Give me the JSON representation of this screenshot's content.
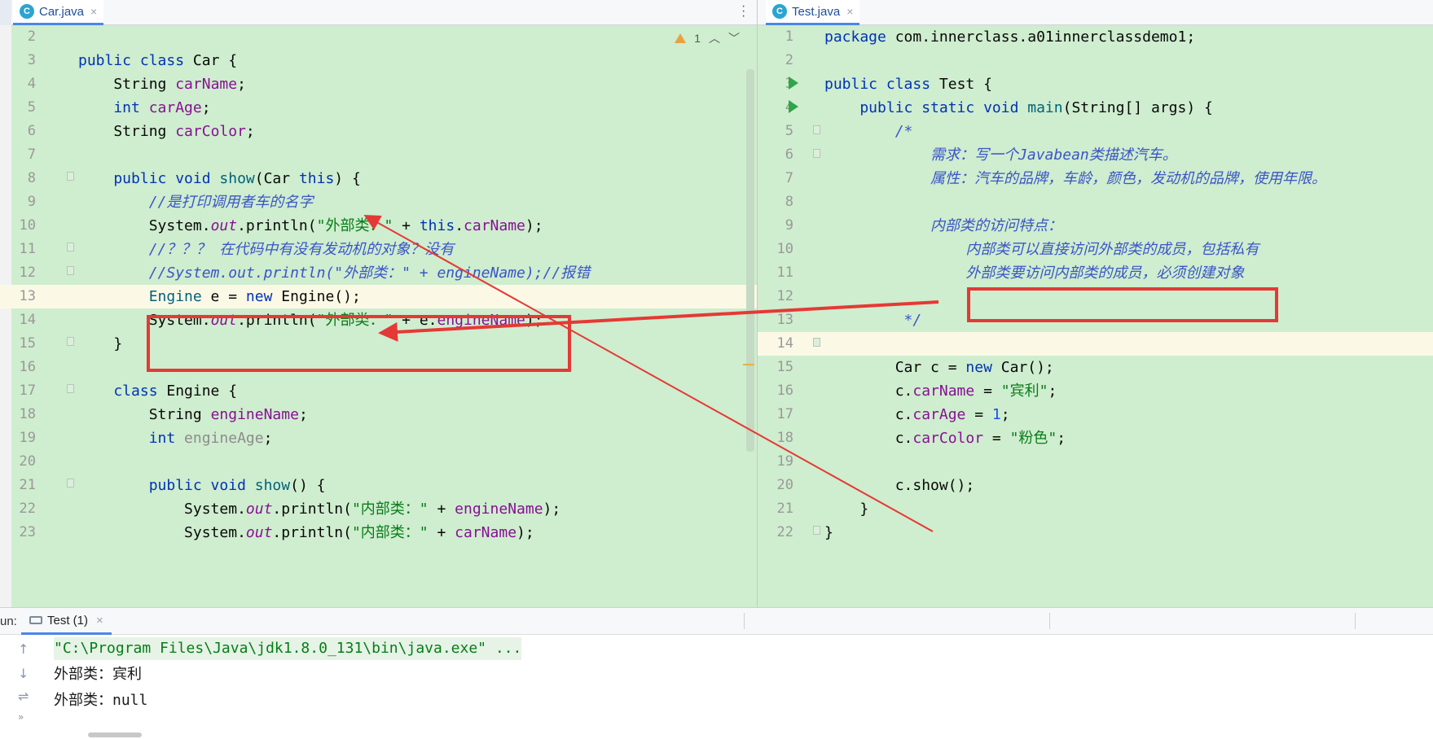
{
  "left_tab": {
    "icon_letter": "C",
    "name": "Car.java",
    "close": "×"
  },
  "right_tab": {
    "icon_letter": "C",
    "name": "Test.java",
    "close": "×"
  },
  "warnings": {
    "count": "1"
  },
  "left_lines": [
    {
      "n": "2",
      "tokens": []
    },
    {
      "n": "3",
      "tokens": [
        [
          "k",
          "public class "
        ],
        [
          "p",
          "Car {"
        ]
      ]
    },
    {
      "n": "4",
      "tokens": [
        [
          "p",
          "    String "
        ],
        [
          "f",
          "carName"
        ],
        [
          "p",
          ";"
        ]
      ]
    },
    {
      "n": "5",
      "tokens": [
        [
          "k",
          "    int "
        ],
        [
          "f",
          "carAge"
        ],
        [
          "p",
          ";"
        ]
      ]
    },
    {
      "n": "6",
      "tokens": [
        [
          "p",
          "    String "
        ],
        [
          "f",
          "carColor"
        ],
        [
          "p",
          ";"
        ]
      ]
    },
    {
      "n": "7",
      "tokens": []
    },
    {
      "n": "8",
      "tokens": [
        [
          "k",
          "    public void "
        ],
        [
          "m",
          "show"
        ],
        [
          "p",
          "(Car "
        ],
        [
          "k",
          "this"
        ],
        [
          "p",
          ") {"
        ]
      ]
    },
    {
      "n": "9",
      "tokens": [
        [
          "c",
          "        //是打印调用者车的名字"
        ]
      ]
    },
    {
      "n": "10",
      "tokens": [
        [
          "p",
          "        System."
        ],
        [
          "i",
          "out"
        ],
        [
          "p",
          ".println("
        ],
        [
          "s",
          "\"外部类：\""
        ],
        [
          "p",
          " + "
        ],
        [
          "k",
          "this"
        ],
        [
          "p",
          "."
        ],
        [
          "f",
          "carName"
        ],
        [
          "p",
          ");"
        ]
      ]
    },
    {
      "n": "11",
      "tokens": [
        [
          "c",
          "        //？？？ 在代码中有没有发动机的对象？没有"
        ]
      ]
    },
    {
      "n": "12",
      "tokens": [
        [
          "c",
          "        //System.out.println(\"外部类：\" + engineName);//报错"
        ]
      ]
    },
    {
      "n": "13",
      "tokens": [
        [
          "m",
          "        Engine"
        ],
        [
          "p",
          " e = "
        ],
        [
          "k",
          "new "
        ],
        [
          "p",
          "Engine();"
        ]
      ]
    },
    {
      "n": "14",
      "tokens": [
        [
          "p",
          "        System."
        ],
        [
          "i",
          "out"
        ],
        [
          "p",
          ".println("
        ],
        [
          "s",
          "\"外部类：\""
        ],
        [
          "p",
          " + e."
        ],
        [
          "f",
          "engineName"
        ],
        [
          "p",
          ");"
        ]
      ]
    },
    {
      "n": "15",
      "tokens": [
        [
          "p",
          "    }"
        ]
      ]
    },
    {
      "n": "16",
      "tokens": []
    },
    {
      "n": "17",
      "tokens": [
        [
          "k",
          "    class "
        ],
        [
          "p",
          "Engine {"
        ]
      ]
    },
    {
      "n": "18",
      "tokens": [
        [
          "p",
          "        String "
        ],
        [
          "f",
          "engineName"
        ],
        [
          "p",
          ";"
        ]
      ]
    },
    {
      "n": "19",
      "tokens": [
        [
          "k",
          "        int "
        ],
        [
          "g",
          "engineAge"
        ],
        [
          "p",
          ";"
        ]
      ]
    },
    {
      "n": "20",
      "tokens": []
    },
    {
      "n": "21",
      "tokens": [
        [
          "k",
          "        public void "
        ],
        [
          "m",
          "show"
        ],
        [
          "p",
          "() {"
        ]
      ]
    },
    {
      "n": "22",
      "tokens": [
        [
          "p",
          "            System."
        ],
        [
          "i",
          "out"
        ],
        [
          "p",
          ".println("
        ],
        [
          "s",
          "\"内部类：\""
        ],
        [
          "p",
          " + "
        ],
        [
          "f",
          "engineName"
        ],
        [
          "p",
          ");"
        ]
      ]
    },
    {
      "n": "23",
      "tokens": [
        [
          "p",
          "            System."
        ],
        [
          "i",
          "out"
        ],
        [
          "p",
          ".println("
        ],
        [
          "s",
          "\"内部类：\""
        ],
        [
          "p",
          " + "
        ],
        [
          "f",
          "carName"
        ],
        [
          "p",
          ");"
        ]
      ]
    }
  ],
  "right_lines": [
    {
      "n": "1",
      "tokens": [
        [
          "k",
          "package "
        ],
        [
          "p",
          "com.innerclass.a01innerclassdemo1;"
        ]
      ]
    },
    {
      "n": "2",
      "tokens": []
    },
    {
      "n": "3",
      "tokens": [
        [
          "k",
          "public class "
        ],
        [
          "p",
          "Test {"
        ]
      ]
    },
    {
      "n": "4",
      "tokens": [
        [
          "k",
          "    public static void "
        ],
        [
          "m",
          "main"
        ],
        [
          "p",
          "(String[] args) {"
        ]
      ]
    },
    {
      "n": "5",
      "tokens": [
        [
          "c",
          "        /*"
        ]
      ]
    },
    {
      "n": "6",
      "tokens": [
        [
          "c",
          "            需求：写一个Javabean类描述汽车。"
        ]
      ]
    },
    {
      "n": "7",
      "tokens": [
        [
          "c",
          "            属性：汽车的品牌，车龄，颜色，发动机的品牌，使用年限。"
        ]
      ]
    },
    {
      "n": "8",
      "tokens": []
    },
    {
      "n": "9",
      "tokens": [
        [
          "c",
          "            内部类的访问特点："
        ]
      ]
    },
    {
      "n": "10",
      "tokens": [
        [
          "c",
          "                内部类可以直接访问外部类的成员，包括私有"
        ]
      ]
    },
    {
      "n": "11",
      "tokens": [
        [
          "c",
          "                外部类要访问内部类的成员，必须创建对象"
        ]
      ]
    },
    {
      "n": "12",
      "tokens": []
    },
    {
      "n": "13",
      "tokens": [
        [
          "c",
          "         */"
        ]
      ]
    },
    {
      "n": "14",
      "tokens": []
    },
    {
      "n": "15",
      "tokens": [
        [
          "p",
          "        Car c = "
        ],
        [
          "k",
          "new "
        ],
        [
          "p",
          "Car();"
        ]
      ]
    },
    {
      "n": "16",
      "tokens": [
        [
          "p",
          "        c."
        ],
        [
          "f",
          "carName"
        ],
        [
          "p",
          " = "
        ],
        [
          "s",
          "\"宾利\""
        ],
        [
          "p",
          ";"
        ]
      ]
    },
    {
      "n": "17",
      "tokens": [
        [
          "p",
          "        c."
        ],
        [
          "f",
          "carAge"
        ],
        [
          "p",
          " = "
        ],
        [
          "n",
          "1"
        ],
        [
          "p",
          ";"
        ]
      ]
    },
    {
      "n": "18",
      "tokens": [
        [
          "p",
          "        c."
        ],
        [
          "f",
          "carColor"
        ],
        [
          "p",
          " = "
        ],
        [
          "s",
          "\"粉色\""
        ],
        [
          "p",
          ";"
        ]
      ]
    },
    {
      "n": "19",
      "tokens": []
    },
    {
      "n": "20",
      "tokens": [
        [
          "p",
          "        c.show();"
        ]
      ]
    },
    {
      "n": "21",
      "tokens": [
        [
          "p",
          "    }"
        ]
      ]
    },
    {
      "n": "22",
      "tokens": [
        [
          "p",
          "}"
        ]
      ]
    }
  ],
  "run": {
    "label": "un:",
    "tab_name": "Test (1)",
    "tab_close": "×",
    "output": [
      "\"C:\\Program Files\\Java\\jdk1.8.0_131\\bin\\java.exe\" ...",
      "外部类：宾利",
      "外部类：null"
    ]
  },
  "colors": {
    "editor_bg": "#cfedcf",
    "current_line": "#fbf9e6",
    "annotation_red": "#e53935",
    "keyword": "#0033b3",
    "field": "#871094",
    "string": "#067d17",
    "comment": "#3a55c7"
  }
}
